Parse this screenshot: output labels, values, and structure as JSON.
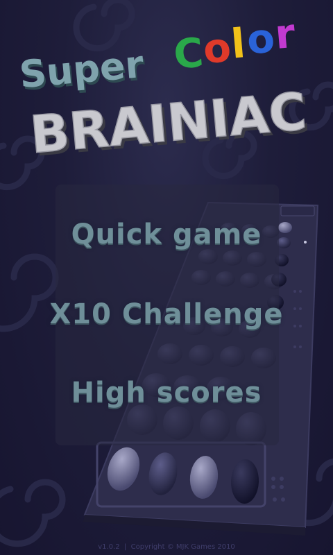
{
  "title": {
    "line1": "Super",
    "color_word": [
      "C",
      "o",
      "l",
      "o",
      "r"
    ],
    "color_letters_colors": [
      "#2aa84a",
      "#e03a2a",
      "#f2c21a",
      "#2a63d8",
      "#c23ad0"
    ],
    "line2": "BRAINIAC"
  },
  "menu": {
    "quick_game": "Quick game",
    "challenge": "X10 Challenge",
    "high_scores": "High scores"
  },
  "footer": {
    "version": "v1.0.2",
    "separator": "|",
    "copyright": "Copyright © MJK Games 2010"
  },
  "colors": {
    "background": "#1e1d3a",
    "menu_text": "#6f8f99",
    "title_text": "#7fa3ad"
  }
}
